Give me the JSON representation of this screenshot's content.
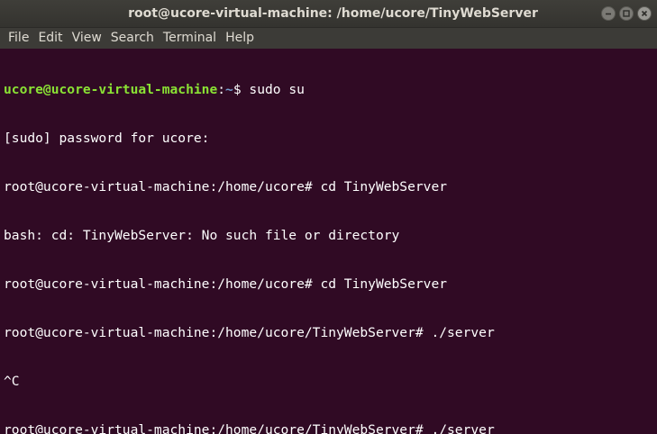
{
  "window": {
    "title": "root@ucore-virtual-machine: /home/ucore/TinyWebServer"
  },
  "menubar": {
    "items": [
      "File",
      "Edit",
      "View",
      "Search",
      "Terminal",
      "Help"
    ]
  },
  "terminal": {
    "first_prompt": {
      "user_host": "ucore@ucore-virtual-machine",
      "separator": ":",
      "path": "~",
      "symbol": "$ ",
      "command": "sudo su"
    },
    "lines": [
      "[sudo] password for ucore:",
      "root@ucore-virtual-machine:/home/ucore# cd TinyWebServer",
      "bash: cd: TinyWebServer: No such file or directory",
      "root@ucore-virtual-machine:/home/ucore# cd TinyWebServer",
      "root@ucore-virtual-machine:/home/ucore/TinyWebServer# ./server",
      "^C",
      "root@ucore-virtual-machine:/home/ucore/TinyWebServer# ./server"
    ]
  },
  "colors": {
    "background": "#300a24",
    "prompt_user": "#8ae234",
    "prompt_path": "#729fcf"
  },
  "icons": [
    "minimize-icon",
    "maximize-icon",
    "close-icon"
  ]
}
